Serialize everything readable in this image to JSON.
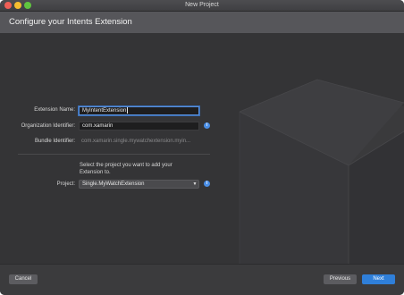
{
  "window": {
    "title": "New Project"
  },
  "header": {
    "title": "Configure your Intents Extension"
  },
  "form": {
    "extension_name": {
      "label": "Extension Name:",
      "value": "MyIntentExtension"
    },
    "organization_identifier": {
      "label": "Organization Identifier:",
      "value": "com.xamarin"
    },
    "bundle_identifier": {
      "label": "Bundle Identifier:",
      "value": "com.xamarin.single.mywatchextension.myin..."
    },
    "project_prompt": "Select the project you want to add your Extension to.",
    "project": {
      "label": "Project:",
      "selected": "Single.MyWatchExtension"
    }
  },
  "icons": {
    "info": "info-icon",
    "dropdown": "chevron-down-icon",
    "close": "close-icon",
    "minimize": "minimize-icon",
    "maximize": "maximize-icon"
  },
  "footer": {
    "cancel_label": "Cancel",
    "previous_label": "Previous",
    "next_label": "Next"
  },
  "colors": {
    "accent": "#2f7fd9",
    "info": "#4a8ee6",
    "focus": "#5a8fd8",
    "background": "#343436"
  }
}
